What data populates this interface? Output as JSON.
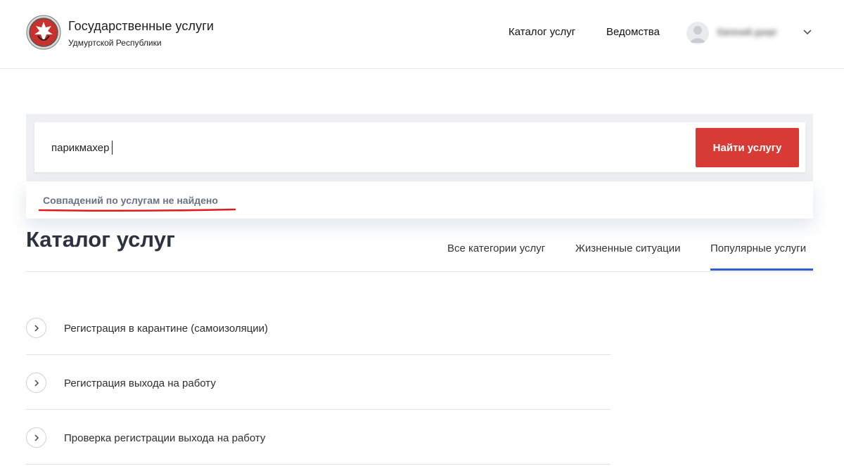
{
  "header": {
    "brand_title": "Государственные услуги",
    "brand_subtitle": "Удмуртской Республики",
    "nav": {
      "catalog": "Каталог услуг",
      "departments": "Ведомства"
    },
    "user_name": "Евгений дзнрг"
  },
  "search": {
    "value": "парикмахер",
    "button_label": "Найти услугу",
    "no_results_text": "Совпадений по услугам не найдено"
  },
  "catalog": {
    "title": "Каталог услуг",
    "tabs": [
      {
        "label": "Все категории услуг",
        "active": false
      },
      {
        "label": "Жизненные ситуации",
        "active": false
      },
      {
        "label": "Популярные услуги",
        "active": true
      }
    ],
    "items": [
      {
        "label": "Регистрация в карантине (самоизоляции)"
      },
      {
        "label": "Регистрация выхода на работу"
      },
      {
        "label": "Проверка регистрации выхода на работу"
      }
    ]
  },
  "colors": {
    "accent_red": "#d83a35",
    "tab_active": "#2f5bd3",
    "search_bg": "#eef0f4",
    "title_color": "#2c3240"
  },
  "icons": {
    "logo": "udmurtia-emblem-icon",
    "avatar": "user-avatar-icon",
    "dropdown": "chevron-down-icon",
    "item_arrow": "chevron-right-icon"
  }
}
